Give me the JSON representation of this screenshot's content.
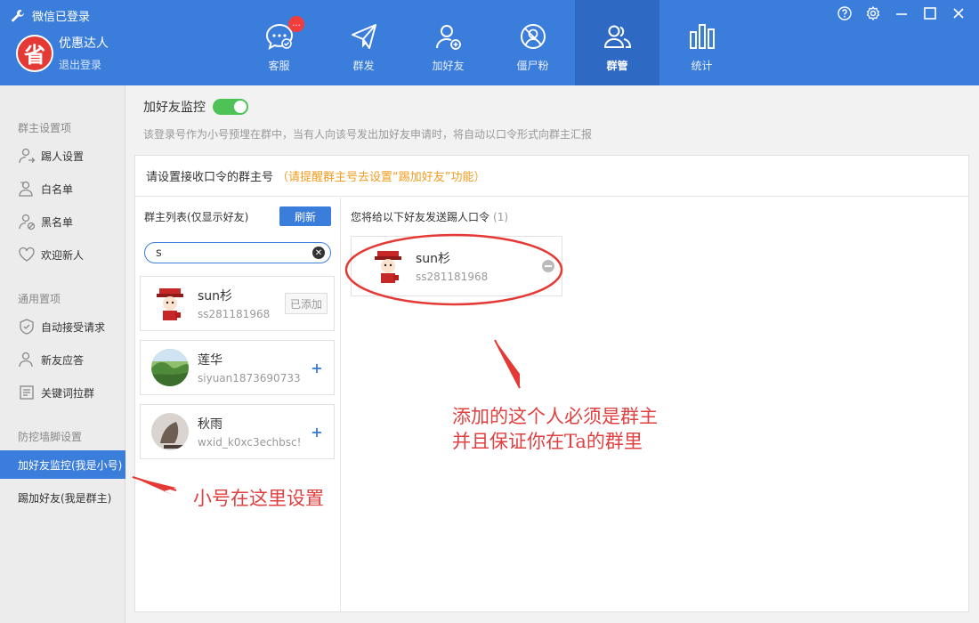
{
  "window": {
    "status": "微信已登录",
    "controls": [
      "help-icon",
      "settings-icon",
      "minimize-icon",
      "maximize-icon",
      "close-icon"
    ]
  },
  "account": {
    "avatar_text": "省",
    "name": "优惠达人",
    "logout": "退出登录"
  },
  "nav": [
    {
      "label": "客服",
      "icon": "chat-icon",
      "badge": "..."
    },
    {
      "label": "群发",
      "icon": "send-icon"
    },
    {
      "label": "加好友",
      "icon": "add-friend-icon"
    },
    {
      "label": "僵尸粉",
      "icon": "zombie-fans-icon"
    },
    {
      "label": "群管",
      "icon": "group-manage-icon",
      "active": true
    },
    {
      "label": "统计",
      "icon": "stats-icon"
    }
  ],
  "sidebar": {
    "sections": [
      "群主设置项",
      "通用置项",
      "防挖墙脚设置"
    ],
    "items": [
      {
        "label": "踢人设置",
        "icon": "kick-user-icon"
      },
      {
        "label": "白名单",
        "icon": "whitelist-icon"
      },
      {
        "label": "黑名单",
        "icon": "blacklist-icon"
      },
      {
        "label": "欢迎新人",
        "icon": "heart-icon"
      },
      {
        "label": "自动接受请求",
        "icon": "shield-icon"
      },
      {
        "label": "新友应答",
        "icon": "user-reply-icon"
      },
      {
        "label": "关键词拉群",
        "icon": "keyword-icon"
      },
      {
        "label": "加好友监控(我是小号)",
        "active": true
      },
      {
        "label": "踢加好友(我是群主)"
      }
    ]
  },
  "main": {
    "toggle_label": "加好友监控",
    "toggle_on": true,
    "description": "该登录号作为小号预埋在群中，当有人向该号发出加好友申请时，将自动以口令形式向群主汇报",
    "panel_title": "请设置接收口令的群主号",
    "panel_warning": "（请提醒群主号去设置“踢加好友”功能）",
    "list_title": "群主列表(仅显示好友)",
    "refresh_label": "刷新",
    "search_value": "s",
    "contacts": [
      {
        "name": "sun杉",
        "id": "ss281181968",
        "action": "已添加"
      },
      {
        "name": "莲华",
        "id": "siyuan1873690733",
        "action": "+"
      },
      {
        "name": "秋雨",
        "id": "wxid_k0xc3echbsc!",
        "action": "+"
      }
    ],
    "selected_title": "您将给以下好友发送踢人口令",
    "selected_count": "(1)",
    "selected": [
      {
        "name": "sun杉",
        "id": "ss281181968"
      }
    ]
  },
  "annotations": {
    "note_main_line1": "添加的这个人必须是群主",
    "note_main_line2": "并且保证你在Ta的群里",
    "note_left": "小号在这里设置"
  },
  "colors": {
    "header_bg": "#3b7ddb",
    "header_active": "#2e69c3",
    "toggle_on": "#4cc257",
    "warning": "#f29c1f",
    "annotation": "#e04040"
  }
}
